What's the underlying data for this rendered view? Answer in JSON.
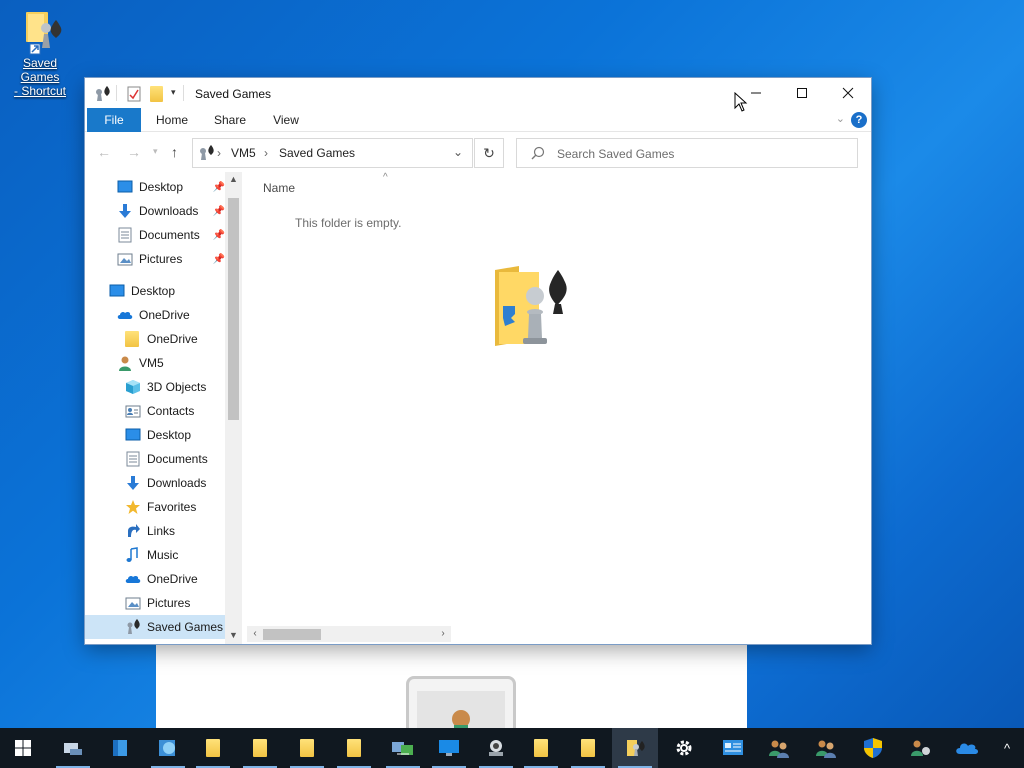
{
  "desktop": {
    "icon_label_line1": "Saved Games",
    "icon_label_line2": "- Shortcut"
  },
  "window": {
    "title": "Saved Games",
    "ribbon_tabs": [
      "File",
      "Home",
      "Share",
      "View"
    ],
    "help_label": "?",
    "address": {
      "segments": [
        "VM5",
        "Saved Games"
      ]
    },
    "search": {
      "placeholder": "Search Saved Games"
    },
    "nav_pane": {
      "quick_access": [
        {
          "label": "Desktop",
          "icon": "desktop-icon"
        },
        {
          "label": "Downloads",
          "icon": "download-arrow-icon"
        },
        {
          "label": "Documents",
          "icon": "document-icon"
        },
        {
          "label": "Pictures",
          "icon": "picture-icon"
        }
      ],
      "tree": [
        {
          "label": "Desktop",
          "icon": "desktop-icon",
          "level": 0
        },
        {
          "label": "OneDrive",
          "icon": "cloud-icon",
          "level": 1
        },
        {
          "label": "OneDrive",
          "icon": "folder-icon",
          "level": 2
        },
        {
          "label": "VM5",
          "icon": "user-icon",
          "level": 1
        },
        {
          "label": "3D Objects",
          "icon": "cube-icon",
          "level": 2
        },
        {
          "label": "Contacts",
          "icon": "contacts-icon",
          "level": 2
        },
        {
          "label": "Desktop",
          "icon": "desktop-icon",
          "level": 2
        },
        {
          "label": "Documents",
          "icon": "document-icon",
          "level": 2
        },
        {
          "label": "Downloads",
          "icon": "download-arrow-icon",
          "level": 2
        },
        {
          "label": "Favorites",
          "icon": "star-icon",
          "level": 2
        },
        {
          "label": "Links",
          "icon": "link-arrow-icon",
          "level": 2
        },
        {
          "label": "Music",
          "icon": "music-note-icon",
          "level": 2
        },
        {
          "label": "OneDrive",
          "icon": "cloud-icon",
          "level": 2
        },
        {
          "label": "Pictures",
          "icon": "picture-icon",
          "level": 2
        },
        {
          "label": "Saved Games",
          "icon": "chess-pawn-icon",
          "level": 2,
          "selected": true
        }
      ]
    },
    "content": {
      "column_name": "Name",
      "empty_message": "This folder is empty."
    }
  },
  "taskbar": {
    "items": [
      "start-windows-icon",
      "server-manager-icon",
      "blue-box-icon",
      "network-globe-icon",
      "folder-icon",
      "folder-icon",
      "folder-icon",
      "folder-icon",
      "remote-connection-icon",
      "monitor-icon",
      "camera-icon",
      "folder-icon",
      "folder-icon",
      "saved-games-icon",
      "gear-icon",
      "control-panel-icon",
      "users-icon",
      "users-icon",
      "shield-icon",
      "user-manager-icon",
      "onedrive-cloud-icon"
    ],
    "tray_chevron": "^"
  },
  "colors": {
    "accent": "#1979ca",
    "selection": "#cce4f7",
    "taskbar": "#101820"
  }
}
